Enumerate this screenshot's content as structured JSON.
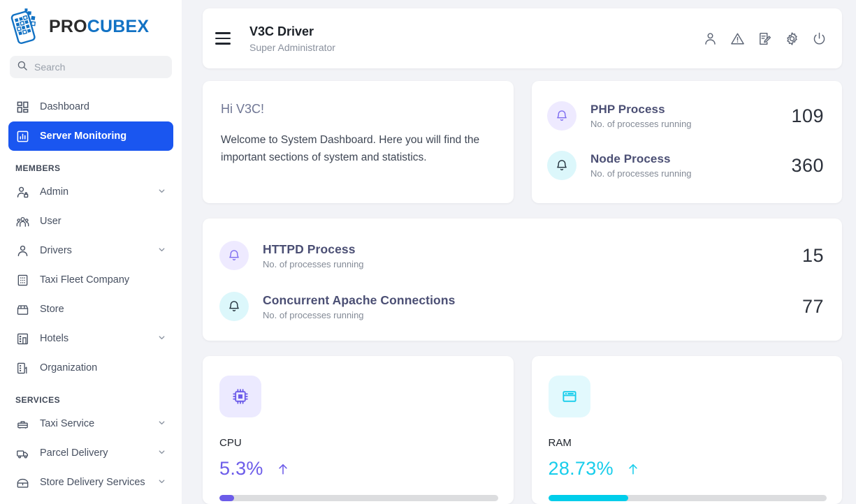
{
  "brand": {
    "name_part1": "PRO",
    "name_part2": "CUBEX",
    "color_primary": "#1272c4",
    "color_dark": "#2b2b2b"
  },
  "sidebar": {
    "search": {
      "placeholder": "Search",
      "value": ""
    },
    "nav": [
      {
        "label": "Dashboard",
        "icon": "grid-icon",
        "active": false,
        "expandable": false
      },
      {
        "label": "Server Monitoring",
        "icon": "chart-bar-icon",
        "active": true,
        "expandable": false
      }
    ],
    "sections": [
      {
        "title": "MEMBERS",
        "items": [
          {
            "label": "Admin",
            "icon": "user-lock-icon",
            "expandable": true
          },
          {
            "label": "User",
            "icon": "users-group-icon",
            "expandable": false
          },
          {
            "label": "Drivers",
            "icon": "user-icon",
            "expandable": true
          },
          {
            "label": "Taxi Fleet Company",
            "icon": "building-grid-icon",
            "expandable": false
          },
          {
            "label": "Store",
            "icon": "storefront-icon",
            "expandable": false
          },
          {
            "label": "Hotels",
            "icon": "hotel-building-icon",
            "expandable": true
          },
          {
            "label": "Organization",
            "icon": "organization-building-icon",
            "expandable": false
          }
        ]
      },
      {
        "title": "SERVICES",
        "items": [
          {
            "label": "Taxi Service",
            "icon": "taxi-icon",
            "expandable": true
          },
          {
            "label": "Parcel Delivery",
            "icon": "delivery-truck-icon",
            "expandable": true
          },
          {
            "label": "Store Delivery Services",
            "icon": "store-delivery-icon",
            "expandable": true
          }
        ]
      }
    ]
  },
  "header": {
    "menu_icon": "hamburger-menu-icon",
    "title": "V3C Driver",
    "subtitle": "Super Administrator",
    "icons": [
      {
        "name": "profile-icon"
      },
      {
        "name": "alert-warning-icon"
      },
      {
        "name": "edit-document-icon"
      },
      {
        "name": "settings-gear-icon"
      },
      {
        "name": "power-logout-icon"
      }
    ]
  },
  "welcome": {
    "greeting": "Hi V3C!",
    "message": "Welcome to System Dashboard. Here you will find the important sections of system and statistics."
  },
  "process_cards": {
    "top_right": [
      {
        "title": "PHP Process",
        "subtitle": "No. of processes running",
        "value": "109",
        "icon": "bell-icon",
        "bubble": "lav"
      },
      {
        "title": "Node Process",
        "subtitle": "No. of processes running",
        "value": "360",
        "icon": "bell-icon",
        "bubble": "cyan"
      }
    ],
    "wide": [
      {
        "title": "HTTPD Process",
        "subtitle": "No. of processes running",
        "value": "15",
        "icon": "bell-icon",
        "bubble": "lav"
      },
      {
        "title": "Concurrent Apache Connections",
        "subtitle": "No. of processes running",
        "value": "77",
        "icon": "bell-icon",
        "bubble": "cyan"
      }
    ]
  },
  "usage": [
    {
      "label": "CPU",
      "value": "5.3%",
      "percent": 5.3,
      "trend": "up",
      "icon": "cpu-chip-icon",
      "color": "#6c5ce9",
      "tile": "lav"
    },
    {
      "label": "RAM",
      "value": "28.73%",
      "percent": 28.73,
      "trend": "up",
      "icon": "memory-window-icon",
      "color": "#18cdeb",
      "tile": "cyan"
    }
  ],
  "colors": {
    "active_nav": "#1a56f0",
    "page_bg": "#f2f3f7",
    "card_bg": "#ffffff",
    "purple": "#6c5ce9",
    "cyan": "#00cdea"
  }
}
